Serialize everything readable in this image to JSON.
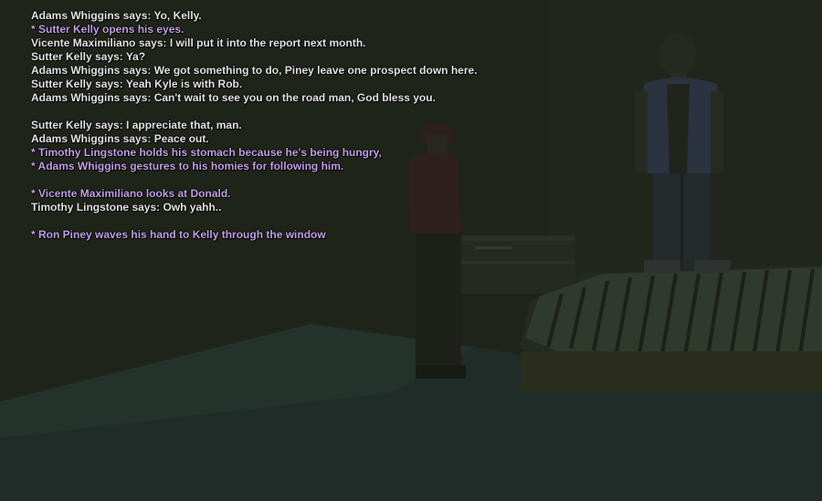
{
  "chat": {
    "lines": [
      {
        "text": "Adams Whiggins says: Yo, Kelly.",
        "kind": "say"
      },
      {
        "text": "* Sutter Kelly opens his eyes.",
        "kind": "me"
      },
      {
        "text": "Vicente Maximiliano says: I will put it into the report next month.",
        "kind": "say"
      },
      {
        "text": "Sutter Kelly says: Ya?",
        "kind": "say"
      },
      {
        "text": "Adams Whiggins says: We got something to do, Piney leave one prospect down here.",
        "kind": "say"
      },
      {
        "text": "Sutter Kelly says: Yeah Kyle is with Rob.",
        "kind": "say"
      },
      {
        "text": "Adams Whiggins says: Can't wait to see you on the road man, God bless you.",
        "kind": "say"
      },
      {
        "text": "",
        "kind": "blank"
      },
      {
        "text": "Sutter Kelly says: I appreciate that, man.",
        "kind": "say"
      },
      {
        "text": "Adams Whiggins says: Peace out.",
        "kind": "say"
      },
      {
        "text": "* Timothy Lingstone holds his stomach because he's being hungry,",
        "kind": "me"
      },
      {
        "text": "* Adams Whiggins gestures to his homies for following him.",
        "kind": "me"
      },
      {
        "text": "",
        "kind": "blank"
      },
      {
        "text": "* Vicente Maximiliano looks at Donald.",
        "kind": "me"
      },
      {
        "text": "Timothy Lingstone says: Owh yahh..",
        "kind": "say"
      },
      {
        "text": "",
        "kind": "blank"
      },
      {
        "text": "* Ron Piney waves his hand to Kelly through the window",
        "kind": "me"
      }
    ]
  },
  "colors": {
    "say_text": "#e8e8e8",
    "action_text": "#c4a4e6",
    "background": "#1d2118"
  }
}
